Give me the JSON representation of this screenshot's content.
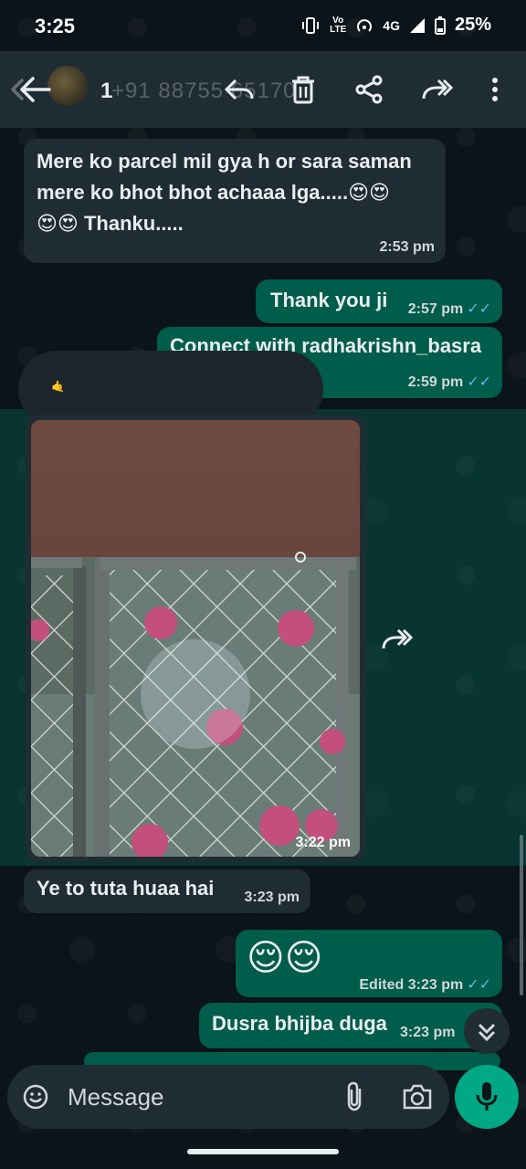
{
  "status_bar": {
    "time": "3:25",
    "volte": "Vo\nLTE",
    "network": "4G",
    "battery": "25%"
  },
  "toolbar": {
    "selected_count": "1",
    "contact_number": "+91 88755 65170",
    "icons": [
      "back-arrow-icon",
      "reply-icon",
      "delete-icon",
      "share-icon",
      "forward-icon",
      "more-vert-icon"
    ]
  },
  "messages": [
    {
      "direction": "in",
      "text_line1": "Mere ko parcel mil gya h or sara saman",
      "text_line2": "mere ko bhot bhot achaaa lga.....😍😍",
      "text_line3": "😍😍 Thanku.....",
      "time": "2:53 pm"
    },
    {
      "direction": "out",
      "text": "Thank you ji",
      "time": "2:57 pm",
      "status": "read"
    },
    {
      "direction": "out",
      "text": "Connect with radhakrishn_basra",
      "time": "2:59 pm",
      "status": "read"
    },
    {
      "direction": "in",
      "type": "image",
      "time": "3:22 pm",
      "selected": true
    },
    {
      "direction": "in",
      "text": "Ye to tuta huaa hai",
      "time": "3:23 pm"
    },
    {
      "direction": "out",
      "text": "😌😌",
      "edited_label": "Edited",
      "time": "3:23 pm",
      "status": "read"
    },
    {
      "direction": "out",
      "text": "Dusra bhijba duga",
      "time": "3:23 pm",
      "status": "read"
    }
  ],
  "overlay_emoji": "🤙",
  "input": {
    "placeholder": "Message"
  },
  "colors": {
    "incoming_bubble": "#202c33",
    "outgoing_bubble": "#005c4b",
    "accent": "#00a884",
    "read_ticks": "#53bdeb"
  }
}
